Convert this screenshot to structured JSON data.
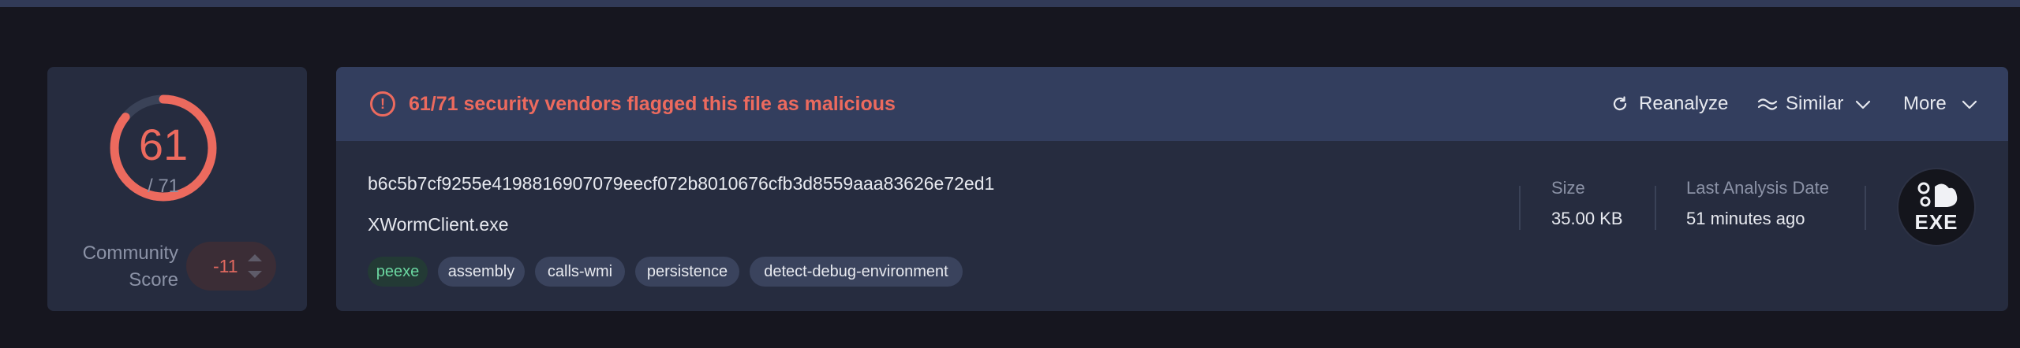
{
  "detection": {
    "malicious": 61,
    "total_label": "/ 71",
    "total": 71,
    "alert_text": "61/71 security vendors flagged this file as malicious",
    "accent_color": "#ec6a5e"
  },
  "community": {
    "label_line1": "Community",
    "label_line2": "Score",
    "value": "-11"
  },
  "actions": {
    "reanalyze": "Reanalyze",
    "similar": "Similar",
    "more": "More"
  },
  "file": {
    "hash": "b6c5b7cf9255e4198816907079eecf072b8010676cfb3d8559aaa83626e72ed1",
    "name": "XWormClient.exe",
    "tags": [
      "peexe",
      "assembly",
      "calls-wmi",
      "persistence",
      "detect-debug-environment"
    ],
    "size_label": "Size",
    "size_value": "35.00 KB",
    "date_label": "Last Analysis Date",
    "date_value": "51 minutes ago",
    "type_badge": "EXE"
  }
}
